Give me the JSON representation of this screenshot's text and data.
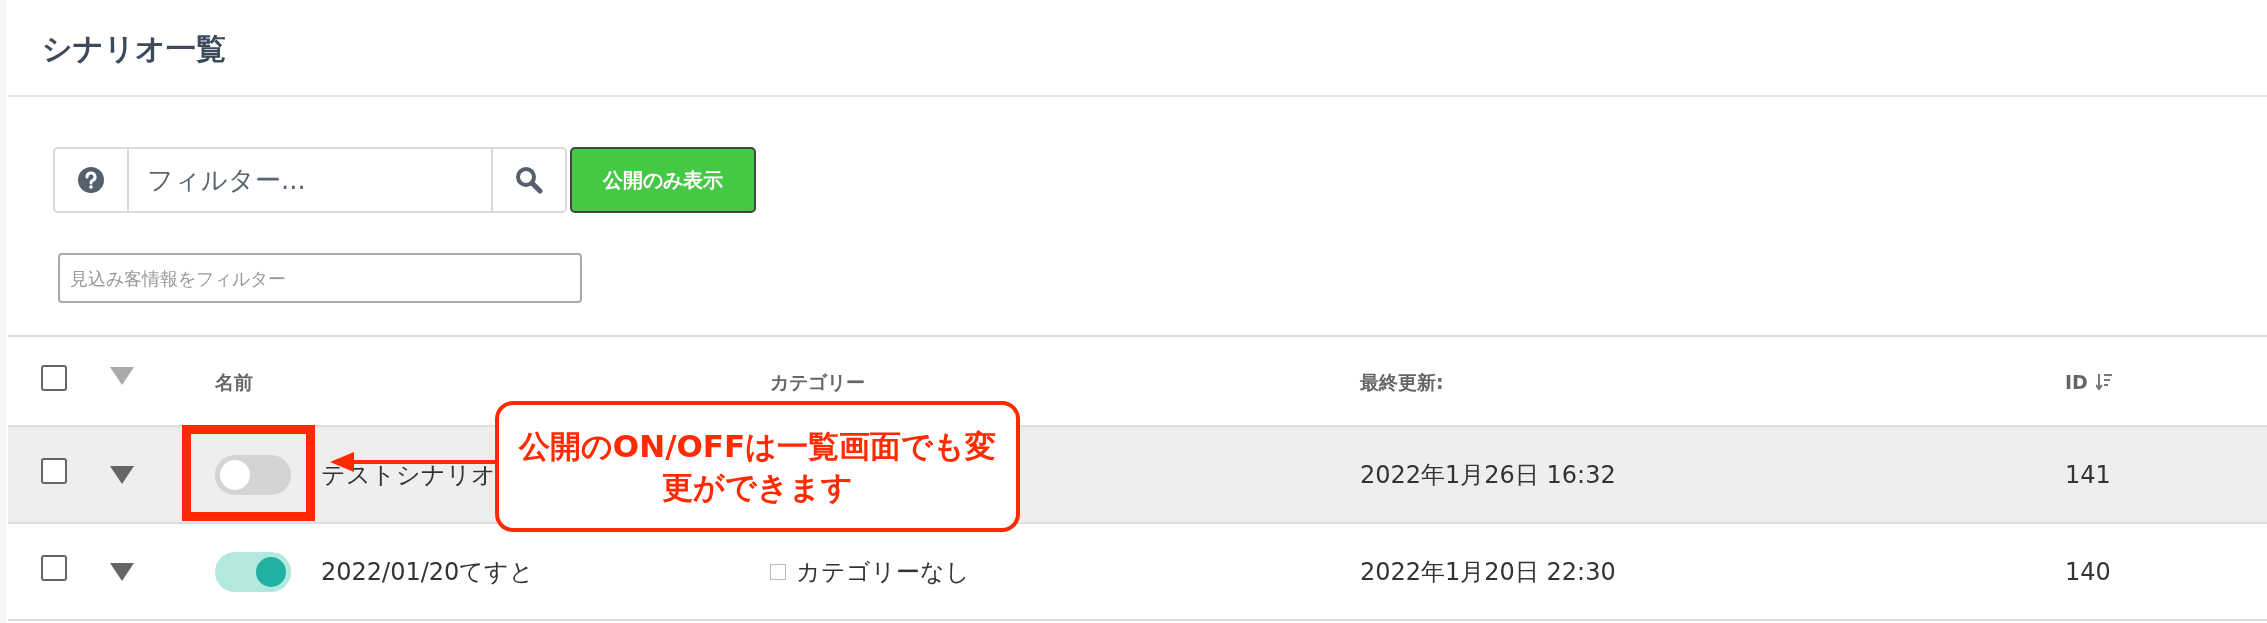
{
  "page": {
    "title": "シナリオ一覧"
  },
  "filter": {
    "placeholder": "フィルター...",
    "public_only_button": "公開のみ表示",
    "lead_filter_placeholder": "見込み客情報をフィルター"
  },
  "table": {
    "all_checked": false,
    "columns": [
      "名前",
      "カテゴリー",
      "最終更新:",
      "ID"
    ],
    "rows": [
      {
        "checked": false,
        "published": false,
        "highlighted": true,
        "name": "テストシナリオ",
        "updated": "2022年1月26日 16:32",
        "id": "141"
      },
      {
        "checked": false,
        "published": true,
        "highlighted": false,
        "name": "2022/01/20てすと",
        "category": "カテゴリーなし",
        "updated": "2022年1月20日 22:30",
        "id": "140"
      }
    ]
  },
  "annotation": {
    "text": "公開のON/OFFは一覧画面でも変更ができます"
  }
}
